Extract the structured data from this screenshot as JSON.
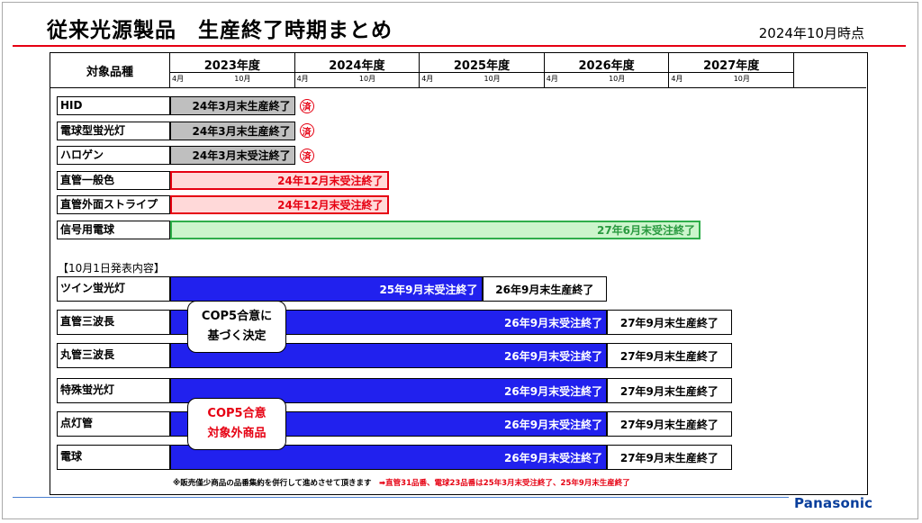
{
  "header": {
    "title": "従来光源製品　生産終了時期まとめ",
    "as_of": "2024年10月時点"
  },
  "chart_data": {
    "type": "gantt",
    "column_header": "対象品種",
    "years": [
      {
        "label": "2023年度",
        "start_month_label": "4月",
        "mid_month_label": "10月"
      },
      {
        "label": "2024年度",
        "start_month_label": "4月",
        "mid_month_label": "10月"
      },
      {
        "label": "2025年度",
        "start_month_label": "4月",
        "mid_month_label": "10月"
      },
      {
        "label": "2026年度",
        "start_month_label": "4月",
        "mid_month_label": "10月"
      },
      {
        "label": "2027年度",
        "start_month_label": "4月",
        "mid_month_label": "10月"
      }
    ],
    "rows": [
      {
        "label": "HID",
        "done_mark": "済",
        "bars": [
          {
            "style": "gray",
            "end": "2024-03",
            "label": "24年3月末生産終了"
          }
        ]
      },
      {
        "label": "電球型蛍光灯",
        "done_mark": "済",
        "bars": [
          {
            "style": "gray",
            "end": "2024-03",
            "label": "24年3月末生産終了"
          }
        ]
      },
      {
        "label": "ハロゲン",
        "done_mark": "済",
        "bars": [
          {
            "style": "gray",
            "end": "2024-03",
            "label": "24年3月末受注終了"
          }
        ]
      },
      {
        "label": "直管一般色",
        "bars": [
          {
            "style": "red",
            "end": "2024-12",
            "label": "24年12月末受注終了"
          }
        ]
      },
      {
        "label": "直管外面ストライプ",
        "bars": [
          {
            "style": "red",
            "end": "2024-12",
            "label": "24年12月末受注終了"
          }
        ]
      },
      {
        "label": "信号用電球",
        "bars": [
          {
            "style": "green",
            "end": "2027-06",
            "label": "27年6月末受注終了"
          }
        ]
      }
    ],
    "announcement_section": "【10月1日発表内容】",
    "announced_rows": [
      {
        "label": "ツイン蛍光灯",
        "bars": [
          {
            "style": "blue",
            "end": "2025-09",
            "label": "25年9月末受注終了"
          },
          {
            "style": "white",
            "start": "2025-09",
            "end": "2026-09",
            "label": "26年9月末生産終了"
          }
        ]
      },
      {
        "label": "直管三波長",
        "bars": [
          {
            "style": "blue",
            "end": "2026-09",
            "label": "26年9月末受注終了"
          },
          {
            "style": "white",
            "start": "2026-09",
            "end": "2027-09",
            "label": "27年9月末生産終了"
          }
        ]
      },
      {
        "label": "丸管三波長",
        "bars": [
          {
            "style": "blue",
            "end": "2026-09",
            "label": "26年9月末受注終了"
          },
          {
            "style": "white",
            "start": "2026-09",
            "end": "2027-09",
            "label": "27年9月末生産終了"
          }
        ]
      },
      {
        "label": "特殊蛍光灯",
        "bars": [
          {
            "style": "blue",
            "end": "2026-09",
            "label": "26年9月末受注終了"
          },
          {
            "style": "white",
            "start": "2026-09",
            "end": "2027-09",
            "label": "27年9月末生産終了"
          }
        ]
      },
      {
        "label": "点灯管",
        "bars": [
          {
            "style": "blue",
            "end": "2026-09",
            "label": "26年9月末受注終了"
          },
          {
            "style": "white",
            "start": "2026-09",
            "end": "2027-09",
            "label": "27年9月末生産終了"
          }
        ]
      },
      {
        "label": "電球",
        "bars": [
          {
            "style": "blue",
            "end": "2026-09",
            "label": "26年9月末受注終了"
          },
          {
            "style": "white",
            "start": "2026-09",
            "end": "2027-09",
            "label": "27年9月末生産終了"
          }
        ]
      }
    ],
    "callouts": [
      {
        "lines": [
          "COP5合意に",
          "基づく決定"
        ],
        "color": "#000000"
      },
      {
        "lines": [
          "COP5合意",
          "対象外商品"
        ],
        "color": "#e60012"
      }
    ],
    "footnote": {
      "text": "※販売僅少商品の品番集約を併行して進めさせて頂きます",
      "highlight": "➡直管31品番、電球23品番は25年3月末受注終了、25年9月末生産終了"
    },
    "colors": {
      "gray": "#bfbfbf",
      "red": "#e60012",
      "green": "#2fae4a",
      "blue": "#2121ee"
    }
  },
  "footer": {
    "logo": "Panasonic"
  }
}
